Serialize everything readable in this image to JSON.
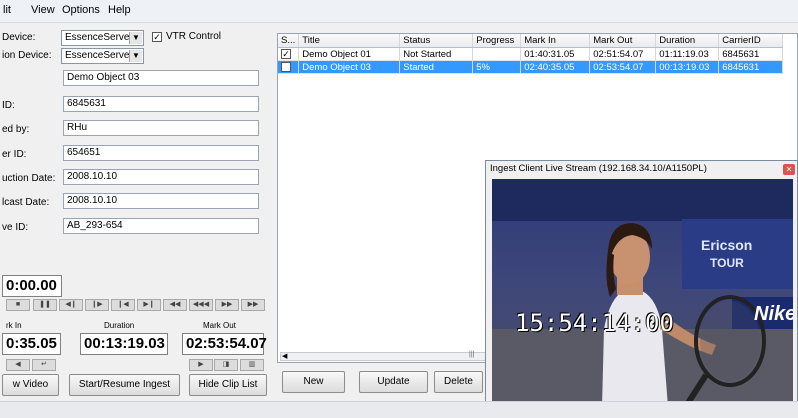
{
  "menu": [
    "lit",
    "View",
    "Options",
    "Help"
  ],
  "form": {
    "device_label": "Device:",
    "device_value": "EssenceServerW",
    "vtr_label": "VTR Control",
    "dest_device_label": "ion Device:",
    "dest_device_value": "EssenceServerN",
    "title_value": "Demo Object 03",
    "id_label": "ID:",
    "id_value": "6845631",
    "created_label": "ed by:",
    "created_value": "RHu",
    "carrier_label": "er ID:",
    "carrier_value": "654651",
    "prod_date_label": "uction Date:",
    "prod_date_value": "2008.10.10",
    "broadcast_label": "lcast Date:",
    "broadcast_value": "2008.10.10",
    "archive_label": "ve ID:",
    "archive_value": "AB_293-654"
  },
  "timecodes": {
    "current": "0:00.00",
    "mark_in_label": "rk In",
    "mark_in": "0:35.05",
    "duration_label": "Duration",
    "duration": "00:13:19.03",
    "mark_out_label": "Mark Out",
    "mark_out": "02:53:54.07"
  },
  "buttons": {
    "preview": "w Video",
    "start": "Start/Resume Ingest",
    "hide": "Hide Clip List",
    "new": "New",
    "update": "Update",
    "delete": "Delete"
  },
  "grid": {
    "headers": [
      "S...",
      "Title",
      "Status",
      "Progress",
      "Mark In",
      "Mark Out",
      "Duration",
      "CarrierID"
    ],
    "rows": [
      {
        "title": "Demo Object 01",
        "status": "Not Started",
        "progress": "",
        "mark_in": "01:40:31.05",
        "mark_out": "02:51:54.07",
        "duration": "01:11:19.03",
        "carrier": "6845631"
      },
      {
        "title": "Demo Object 03",
        "status": "Started",
        "progress": "5%",
        "mark_in": "02:40:35.05",
        "mark_out": "02:53:54.07",
        "duration": "00:13:19.03",
        "carrier": "6845631"
      }
    ]
  },
  "stream": {
    "title": "Ingest Client Live Stream  (192.168.34.10/A1150PL)",
    "overlay_timecode": "15:54:14:00",
    "sign_1": "Ericson",
    "sign_2": "TOUR",
    "sign_3": "Nike"
  }
}
